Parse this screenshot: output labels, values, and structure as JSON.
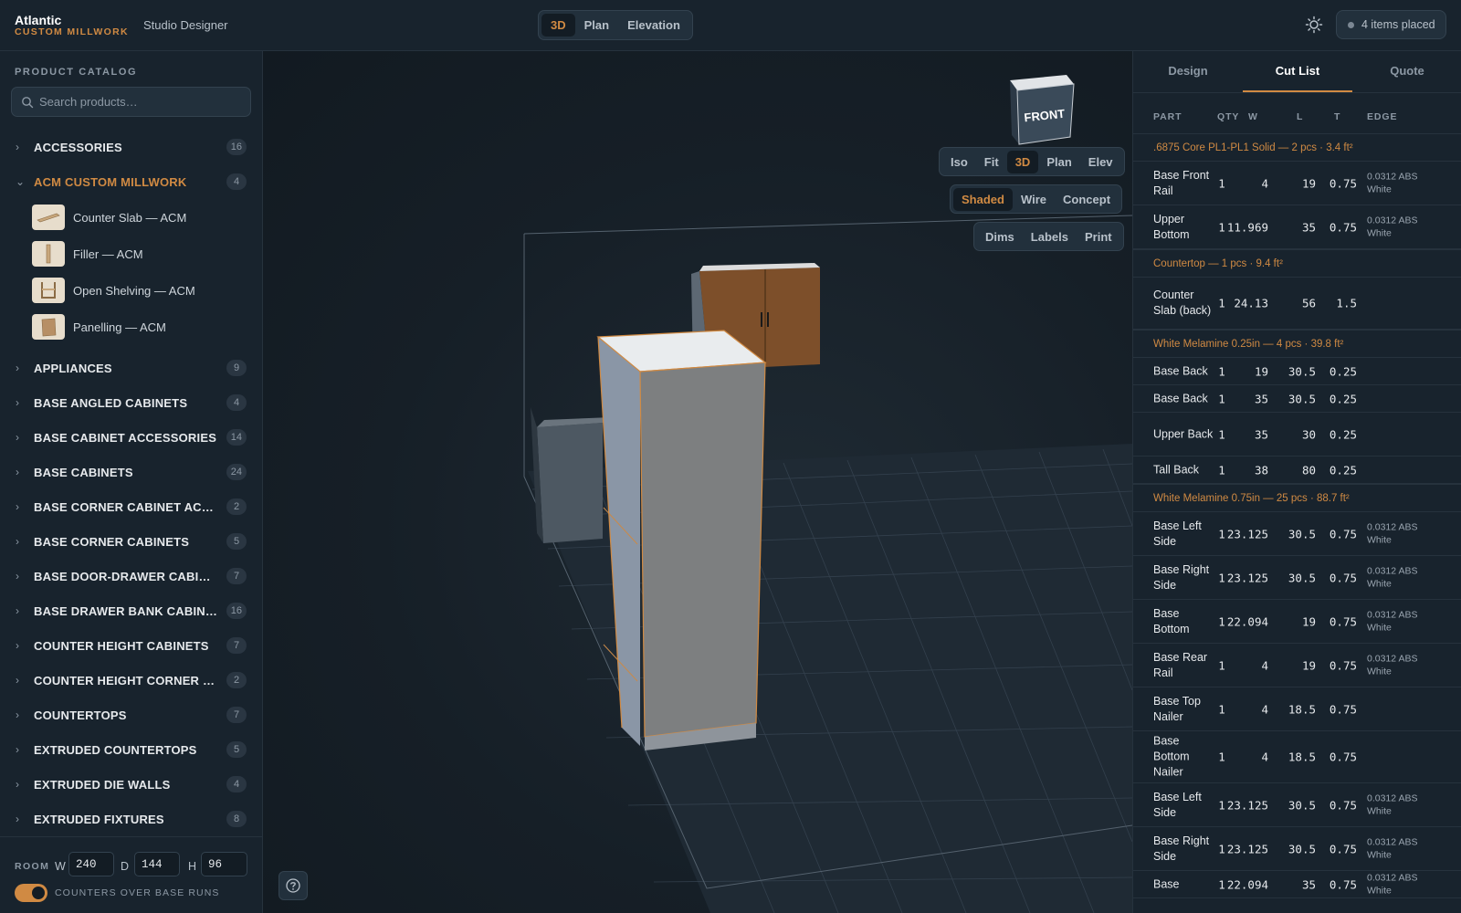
{
  "header": {
    "brand_name": "Atlantic",
    "brand_sub": "CUSTOM MILLWORK",
    "app_title": "Studio Designer",
    "modes": [
      "3D",
      "Plan",
      "Elevation"
    ],
    "active_mode": "3D",
    "items_status": "4 items placed",
    "theme_icon": "sun-icon"
  },
  "sidebar": {
    "title": "PRODUCT CATALOG",
    "search_placeholder": "Search products…",
    "categories": [
      {
        "label": "ACCESSORIES",
        "count": "16",
        "expanded": false
      },
      {
        "label": "ACM CUSTOM MILLWORK",
        "count": "4",
        "expanded": true,
        "items": [
          "Counter Slab — ACM",
          "Filler — ACM",
          "Open Shelving — ACM",
          "Panelling — ACM"
        ]
      },
      {
        "label": "APPLIANCES",
        "count": "9",
        "expanded": false
      },
      {
        "label": "BASE ANGLED CABINETS",
        "count": "4",
        "expanded": false
      },
      {
        "label": "BASE CABINET ACCESSORIES",
        "count": "14",
        "expanded": false
      },
      {
        "label": "BASE CABINETS",
        "count": "24",
        "expanded": false
      },
      {
        "label": "BASE CORNER CABINET ACCE...",
        "count": "2",
        "expanded": false
      },
      {
        "label": "BASE CORNER CABINETS",
        "count": "5",
        "expanded": false
      },
      {
        "label": "BASE DOOR-DRAWER CABINETS",
        "count": "7",
        "expanded": false
      },
      {
        "label": "BASE DRAWER BANK CABINET",
        "count": "16",
        "expanded": false
      },
      {
        "label": "COUNTER HEIGHT CABINETS",
        "count": "7",
        "expanded": false
      },
      {
        "label": "COUNTER HEIGHT CORNER CA...",
        "count": "2",
        "expanded": false
      },
      {
        "label": "COUNTERTOPS",
        "count": "7",
        "expanded": false
      },
      {
        "label": "EXTRUDED COUNTERTOPS",
        "count": "5",
        "expanded": false
      },
      {
        "label": "EXTRUDED DIE WALLS",
        "count": "4",
        "expanded": false
      },
      {
        "label": "EXTRUDED FIXTURES",
        "count": "8",
        "expanded": false
      }
    ],
    "room": {
      "label": "ROOM",
      "w_label": "W",
      "w_value": "240",
      "d_label": "D",
      "d_value": "144",
      "h_label": "H",
      "h_value": "96",
      "toggle_label": "COUNTERS OVER BASE RUNS",
      "toggle_on": true
    }
  },
  "viewport": {
    "cube_face": "FRONT",
    "view_buttons": [
      "Iso",
      "Fit",
      "3D",
      "Plan",
      "Elev"
    ],
    "active_view": "3D",
    "render_buttons": [
      "Shaded",
      "Wire",
      "Concept"
    ],
    "active_render": "Shaded",
    "overlay_buttons": [
      "Dims",
      "Labels",
      "Print"
    ],
    "help_icon": "question-icon"
  },
  "right_panel": {
    "tabs": [
      "Design",
      "Cut List",
      "Quote"
    ],
    "active_tab": "Cut List",
    "columns": [
      "PART",
      "QTY",
      "W",
      "L",
      "T",
      "EDGE"
    ],
    "groups": [
      {
        "header": ".6875 Core PL1-PL1 Solid — 2 pcs · 3.4 ft²",
        "rows": [
          {
            "part": "Base Front Rail",
            "qty": "1",
            "w": "4",
            "l": "19",
            "t": "0.75",
            "edge": "0.0312 ABS White"
          },
          {
            "part": "Upper Bottom",
            "qty": "1",
            "w": "11.969",
            "l": "35",
            "t": "0.75",
            "edge": "0.0312 ABS White"
          }
        ]
      },
      {
        "header": "Countertop — 1 pcs · 9.4 ft²",
        "rows": [
          {
            "part": "Counter Slab (back)",
            "qty": "1",
            "w": "24.13",
            "l": "56",
            "t": "1.5",
            "edge": ""
          }
        ]
      },
      {
        "header": "White Melamine 0.25in — 4 pcs · 39.8 ft²",
        "rows": [
          {
            "part": "Base Back",
            "qty": "1",
            "w": "19",
            "l": "30.5",
            "t": "0.25",
            "edge": ""
          },
          {
            "part": "Base Back",
            "qty": "1",
            "w": "35",
            "l": "30.5",
            "t": "0.25",
            "edge": ""
          },
          {
            "part": "Upper Back",
            "qty": "1",
            "w": "35",
            "l": "30",
            "t": "0.25",
            "edge": ""
          },
          {
            "part": "Tall Back",
            "qty": "1",
            "w": "38",
            "l": "80",
            "t": "0.25",
            "edge": ""
          }
        ]
      },
      {
        "header": "White Melamine 0.75in — 25 pcs · 88.7 ft²",
        "rows": [
          {
            "part": "Base Left Side",
            "qty": "1",
            "w": "23.125",
            "l": "30.5",
            "t": "0.75",
            "edge": "0.0312 ABS White"
          },
          {
            "part": "Base Right Side",
            "qty": "1",
            "w": "23.125",
            "l": "30.5",
            "t": "0.75",
            "edge": "0.0312 ABS White"
          },
          {
            "part": "Base Bottom",
            "qty": "1",
            "w": "22.094",
            "l": "19",
            "t": "0.75",
            "edge": "0.0312 ABS White"
          },
          {
            "part": "Base Rear Rail",
            "qty": "1",
            "w": "4",
            "l": "19",
            "t": "0.75",
            "edge": "0.0312 ABS White"
          },
          {
            "part": "Base Top Nailer",
            "qty": "1",
            "w": "4",
            "l": "18.5",
            "t": "0.75",
            "edge": ""
          },
          {
            "part": "Base Bottom Nailer",
            "qty": "1",
            "w": "4",
            "l": "18.5",
            "t": "0.75",
            "edge": ""
          },
          {
            "part": "Base Left Side",
            "qty": "1",
            "w": "23.125",
            "l": "30.5",
            "t": "0.75",
            "edge": "0.0312 ABS White"
          },
          {
            "part": "Base Right Side",
            "qty": "1",
            "w": "23.125",
            "l": "30.5",
            "t": "0.75",
            "edge": "0.0312 ABS White"
          },
          {
            "part": "Base",
            "qty": "1",
            "w": "22.094",
            "l": "35",
            "t": "0.75",
            "edge": "0.0312 ABS White"
          }
        ]
      }
    ]
  },
  "colors": {
    "accent": "#d08a43",
    "background": "#131c24",
    "panel": "#18232d",
    "cabinet_door": "#7d4f2a",
    "cabinet_body": "#7d7f80"
  }
}
